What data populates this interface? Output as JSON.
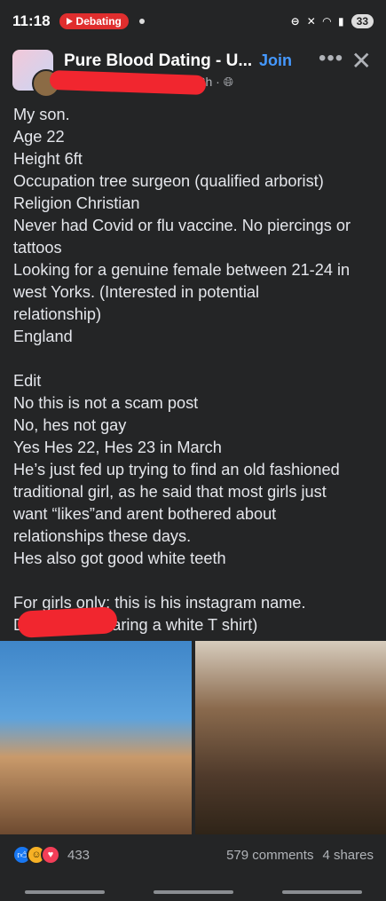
{
  "status": {
    "time": "11:18",
    "app_pill": "Debating",
    "battery": "33"
  },
  "header": {
    "group_name": "Pure Blood Dating - U...",
    "join_label": "Join",
    "more_icon": "more-icon",
    "close_icon": "close-icon",
    "time_ago": "22h",
    "privacy_icon": "globe-icon"
  },
  "post_lines": [
    "My son.",
    "Age 22",
    "Height 6ft",
    "Occupation tree surgeon (qualified arborist)",
    "Religion Christian",
    "Never had Covid or flu vaccine. No piercings or",
    "tattoos",
    "Looking for a genuine female between 21-24 in",
    "west Yorks.  (Interested in potential",
    "relationship)",
    "England",
    "",
    "Edit",
    "No this is not a scam post",
    "No, hes not gay",
    "Yes Hes 22, Hes 23 in March",
    "He’s just fed up trying to find an old fashioned",
    "traditional girl, as he said that most girls just",
    "want “likes”and arent bothered about",
    "relationships these days.",
    "Hes also got good white teeth",
    "",
    "For girls only: this is his instagram name.",
    "D                      and hes wearing a white T shirt)"
  ],
  "footer": {
    "reaction_count": "433",
    "comments": "579 comments",
    "shares": "4 shares"
  },
  "colors": {
    "background": "#242526",
    "accent": "#4599ff",
    "redaction": "#f1262f"
  }
}
